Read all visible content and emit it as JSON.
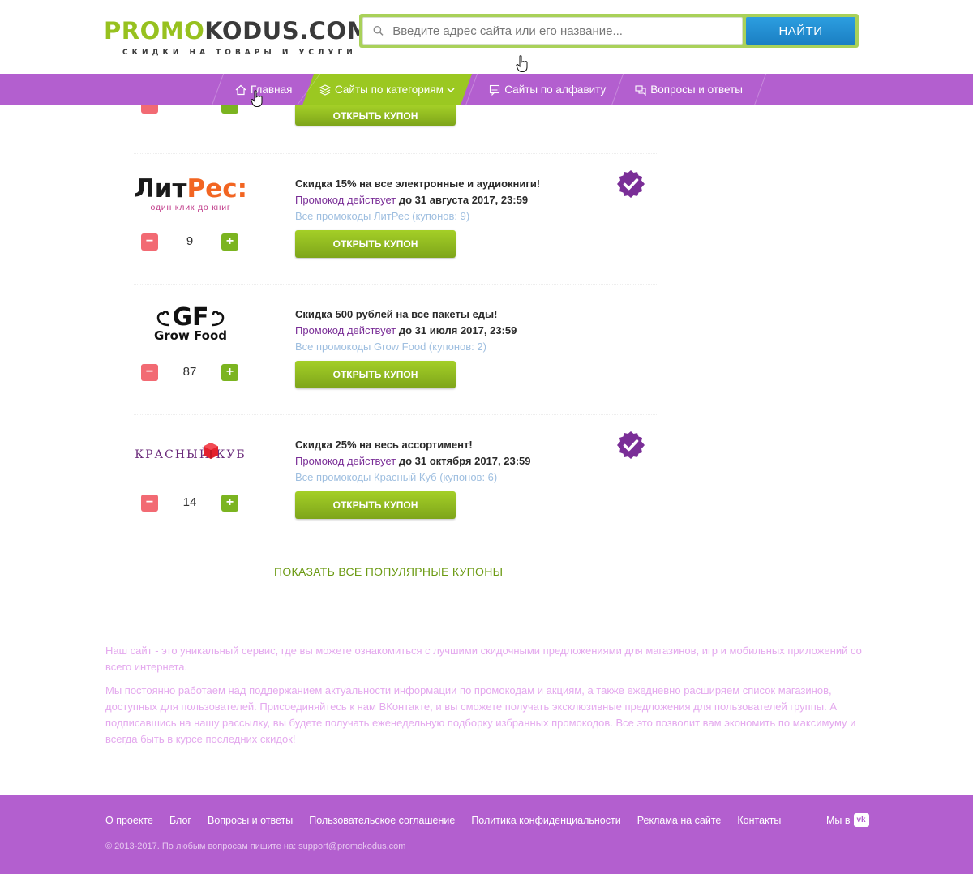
{
  "header": {
    "logo": {
      "part1": "PROMO",
      "part2": "KODUS.COM",
      "tagline": "СКИДКИ НА ТОВАРЫ И УСЛУГИ"
    },
    "search": {
      "placeholder": "Введите адрес сайта или его название...",
      "button_label": "НАЙТИ"
    }
  },
  "nav": {
    "items": [
      {
        "label": "Главная",
        "icon": "home-icon"
      },
      {
        "label": "Сайты по категориям",
        "icon": "layers-icon",
        "active": true
      },
      {
        "label": "Сайты по алфавиту",
        "icon": "list-icon"
      },
      {
        "label": "Вопросы и ответы",
        "icon": "chat-icon"
      }
    ]
  },
  "top_partial": {
    "button_label": "ОТКРЫТЬ КУПОН"
  },
  "coupons": [
    {
      "logo_text": "ЛитРес:",
      "logo_sub": "один клик до книг",
      "votes": "9",
      "title": "Скидка 15% на все электронные и аудиокниги!",
      "expire_label": "Промокод действует",
      "expire_date": "до 31 августа 2017, 23:59",
      "all_link": "Все промокоды ЛитРес (купонов: 9)",
      "button_label": "ОТКРЫТЬ КУПОН",
      "verified": true
    },
    {
      "logo_text": "GF",
      "logo_sub": "Grow Food",
      "votes": "87",
      "title": "Скидка 500 рублей на все пакеты еды!",
      "expire_label": "Промокод действует",
      "expire_date": "до 31 июля 2017, 23:59",
      "all_link": "Все промокоды Grow Food (купонов: 2)",
      "button_label": "ОТКРЫТЬ КУПОН",
      "verified": false
    },
    {
      "logo_text": "КРАСНЫЙ КУБ",
      "logo_sub": "",
      "votes": "14",
      "title": "Скидка 25% на весь ассортимент!",
      "expire_label": "Промокод действует",
      "expire_date": "до 31 октября 2017, 23:59",
      "all_link": "Все промокоды Красный Куб (купонов: 6)",
      "button_label": "ОТКРЫТЬ КУПОН",
      "verified": true
    }
  ],
  "show_all_label": "ПОКАЗАТЬ ВСЕ ПОПУЛЯРНЫЕ КУПОНЫ",
  "about": {
    "p1": "Наш сайт - это уникальный сервис, где вы можете ознакомиться с лучшими скидочными предложениями для магазинов, игр и мобильных приложений со всего интернета.",
    "p2": "Мы постоянно работаем над поддержанием актуальности информации по промокодам и акциям, а также ежедневно расширяем список магазинов, доступных для пользователей. Присоединяйтесь к нам ВКонтакте, и вы сможете получать эксклюзивные предложения для пользователей группы. А подписавшись на нашу рассылку, вы будете получать еженедельную подборку избранных промокодов. Все это позволит вам экономить по максимуму и всегда быть в курсе последних скидок!"
  },
  "footer": {
    "links": [
      "О проекте",
      "Блог",
      "Вопросы и ответы",
      "Пользовательское соглашение",
      "Политика конфиденциальности",
      "Реклама на сайте",
      "Контакты"
    ],
    "social_label": "Мы в",
    "vk": "vk",
    "copyright": "© 2013-2017. По любым вопросам пишите на: support@promokodus.com"
  },
  "colors": {
    "brand_green": "#97c11f",
    "nav_purple": "#b35fcf",
    "search_blue": "#1b7fc3",
    "verified_purple": "#7a2e97"
  }
}
